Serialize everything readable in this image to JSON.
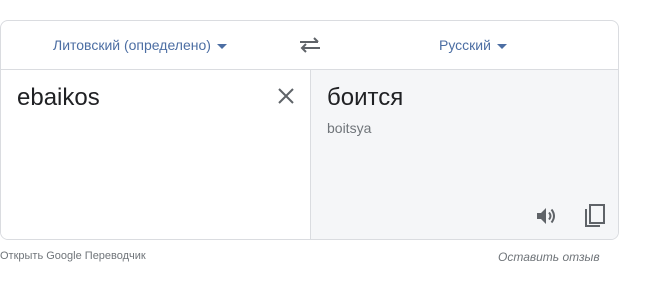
{
  "header": {
    "source_language": "Литовский (определено)",
    "target_language": "Русский"
  },
  "source": {
    "text": "ebaikos"
  },
  "target": {
    "text": "боится",
    "transliteration": "boitsya"
  },
  "footer": {
    "open_link": "Открыть Google Переводчик",
    "feedback_link": "Оставить отзыв"
  },
  "icons": {
    "caret": "chevron-down-icon",
    "swap": "swap-arrows-icon",
    "clear": "close-icon",
    "speaker": "speaker-icon",
    "copy": "copy-icon"
  },
  "colors": {
    "link_blue": "#4c6ea3",
    "icon_gray": "#5f6368",
    "translation_bg": "#f5f6f8",
    "border": "#dadce0"
  }
}
